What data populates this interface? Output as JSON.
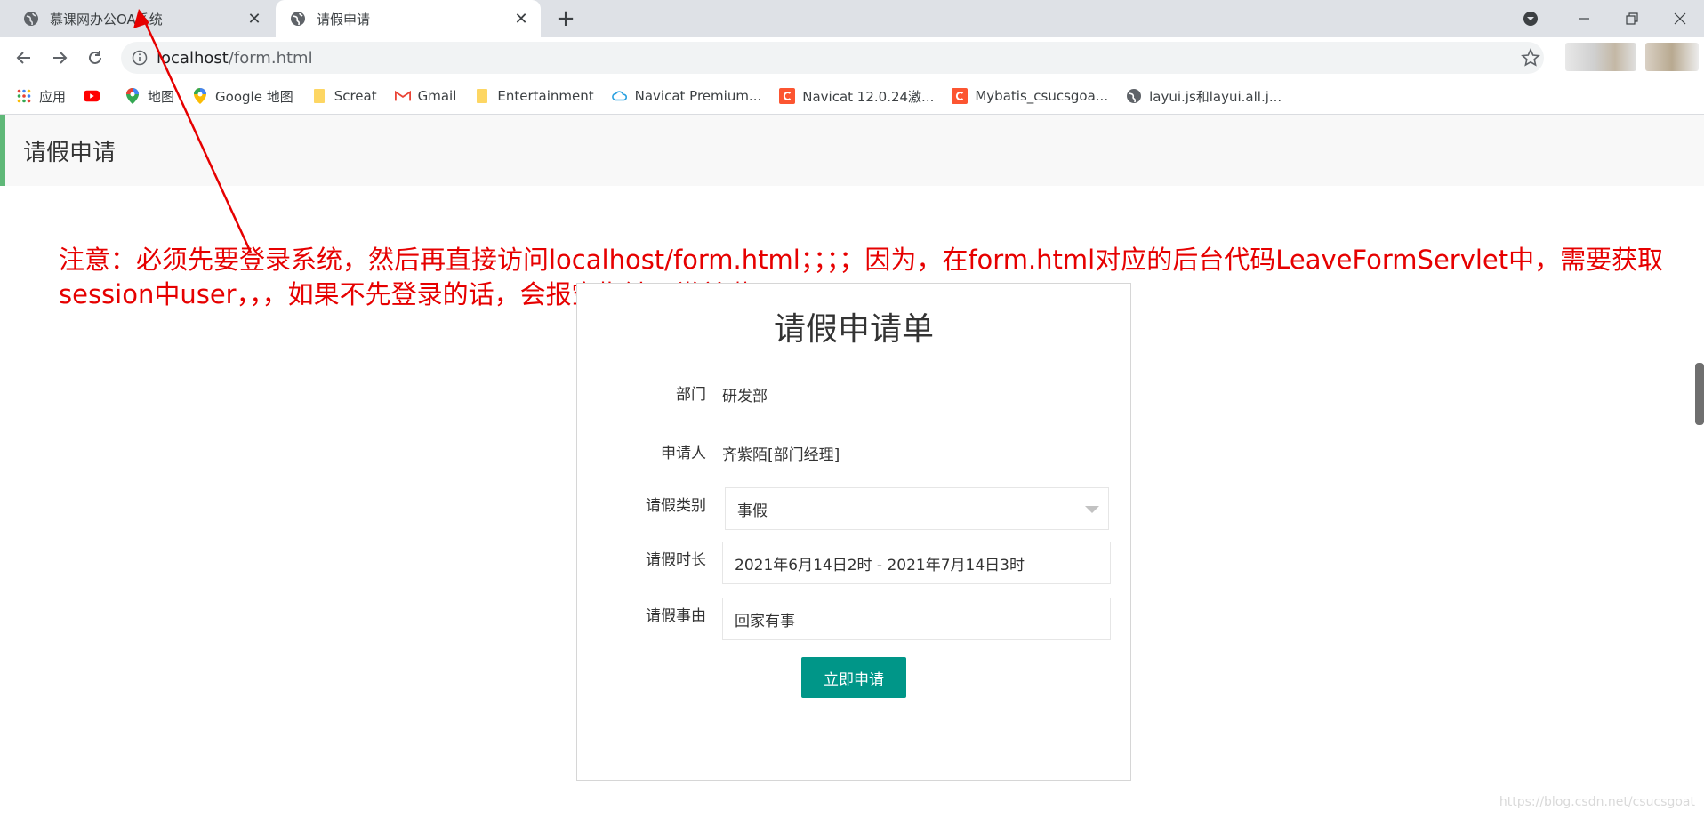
{
  "browser": {
    "tabs": [
      {
        "title": "慕课网办公OA系统",
        "active": false
      },
      {
        "title": "请假申请",
        "active": true
      }
    ],
    "url_host": "localhost",
    "url_path": "/form.html",
    "accent_color": "#1a73e8"
  },
  "bookmarks": [
    {
      "label": "应用",
      "icon": "apps-grid-icon"
    },
    {
      "label": "",
      "icon": "youtube-icon"
    },
    {
      "label": "地图",
      "icon": "maps-pin-icon"
    },
    {
      "label": "Google 地图",
      "icon": "maps-pin-icon"
    },
    {
      "label": "Screat",
      "icon": "folder-icon"
    },
    {
      "label": "Gmail",
      "icon": "gmail-icon"
    },
    {
      "label": "Entertainment",
      "icon": "folder-icon"
    },
    {
      "label": "Navicat Premium...",
      "icon": "cloud-icon"
    },
    {
      "label": "Navicat 12.0.24激...",
      "icon": "csdn-icon"
    },
    {
      "label": "Mybatis_csucsgoa...",
      "icon": "csdn-icon"
    },
    {
      "label": "layui.js和layui.all.j...",
      "icon": "globe-icon"
    }
  ],
  "page": {
    "header_title": "请假申请",
    "annotation": "注意：必须先要登录系统，然后再直接访问localhost/form.html；；；；因为，在form.html对应的后台代码LeaveFormServlet中，需要获取session中user，，，如果不先登录的话，会报空指针异常单啦；",
    "annotation_color": "#e60000"
  },
  "form": {
    "title": "请假申请单",
    "department_label": "部门",
    "department_value": "研发部",
    "applicant_label": "申请人",
    "applicant_value": "齐紫陌[部门经理]",
    "type_label": "请假类别",
    "type_value": "事假",
    "duration_label": "请假时长",
    "duration_value": "2021年6月14日2时 - 2021年7月14日3时",
    "reason_label": "请假事由",
    "reason_value": "回家有事",
    "submit_label": "立即申请",
    "submit_color": "#009688"
  },
  "watermark": "https://blog.csdn.net/csucsgoat"
}
